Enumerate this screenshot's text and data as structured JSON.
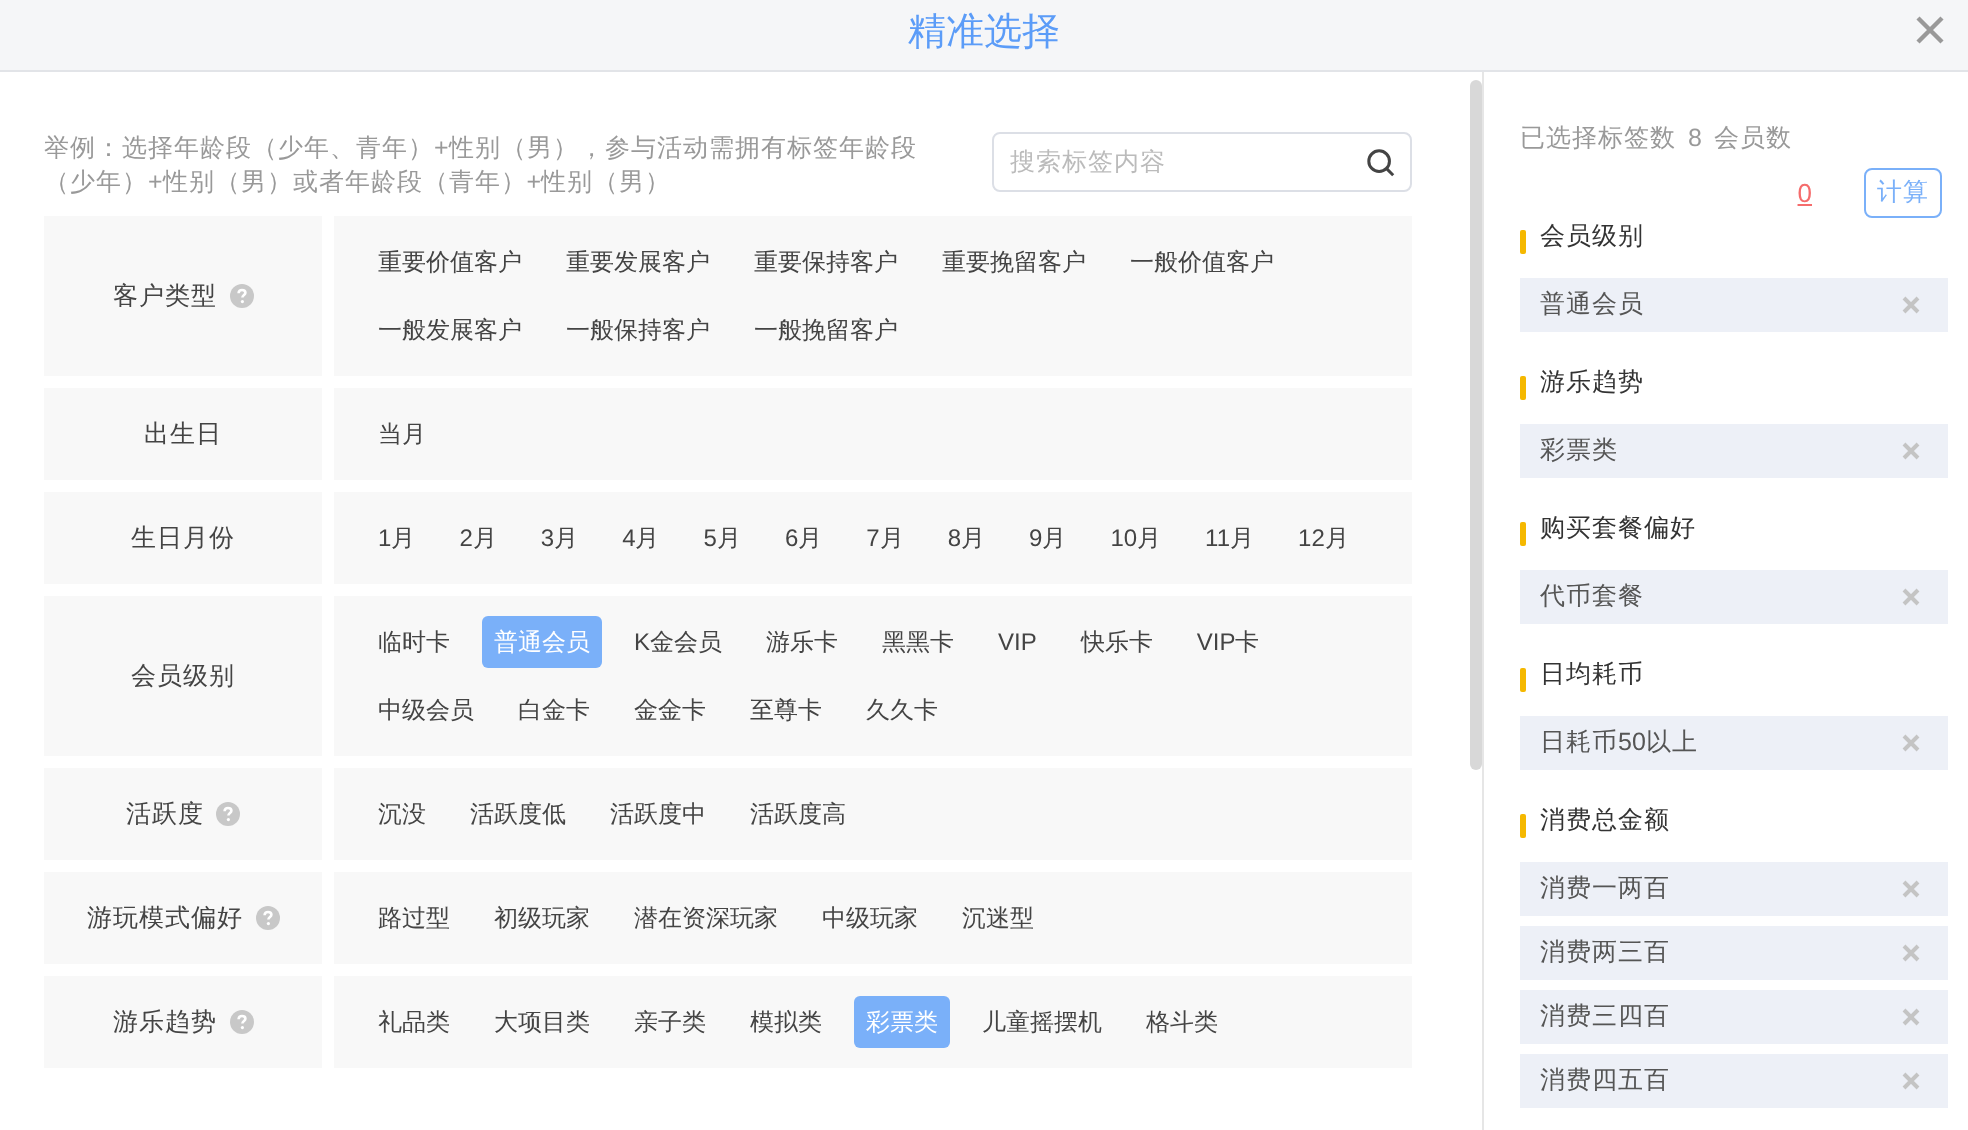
{
  "dialog": {
    "title": "精准选择"
  },
  "hint": "举例：选择年龄段（少年、青年）+性别（男），参与活动需拥有标签年龄段（少年）+性别（男）或者年龄段（青年）+性别（男）",
  "search": {
    "placeholder": "搜索标签内容"
  },
  "categories": [
    {
      "label": "客户类型",
      "help": true,
      "tags": [
        {
          "label": "重要价值客户",
          "selected": false
        },
        {
          "label": "重要发展客户",
          "selected": false
        },
        {
          "label": "重要保持客户",
          "selected": false
        },
        {
          "label": "重要挽留客户",
          "selected": false
        },
        {
          "label": "一般价值客户",
          "selected": false
        },
        {
          "label": "一般发展客户",
          "selected": false
        },
        {
          "label": "一般保持客户",
          "selected": false
        },
        {
          "label": "一般挽留客户",
          "selected": false
        }
      ]
    },
    {
      "label": "出生日",
      "help": false,
      "tags": [
        {
          "label": "当月",
          "selected": false
        }
      ]
    },
    {
      "label": "生日月份",
      "help": false,
      "tags": [
        {
          "label": "1月",
          "selected": false
        },
        {
          "label": "2月",
          "selected": false
        },
        {
          "label": "3月",
          "selected": false
        },
        {
          "label": "4月",
          "selected": false
        },
        {
          "label": "5月",
          "selected": false
        },
        {
          "label": "6月",
          "selected": false
        },
        {
          "label": "7月",
          "selected": false
        },
        {
          "label": "8月",
          "selected": false
        },
        {
          "label": "9月",
          "selected": false
        },
        {
          "label": "10月",
          "selected": false
        },
        {
          "label": "11月",
          "selected": false
        },
        {
          "label": "12月",
          "selected": false
        }
      ]
    },
    {
      "label": "会员级别",
      "help": false,
      "tags": [
        {
          "label": "临时卡",
          "selected": false
        },
        {
          "label": "普通会员",
          "selected": true
        },
        {
          "label": "K金会员",
          "selected": false
        },
        {
          "label": "游乐卡",
          "selected": false
        },
        {
          "label": "黑黑卡",
          "selected": false
        },
        {
          "label": "VIP",
          "selected": false
        },
        {
          "label": "快乐卡",
          "selected": false
        },
        {
          "label": "VIP卡",
          "selected": false
        },
        {
          "label": "中级会员",
          "selected": false
        },
        {
          "label": "白金卡",
          "selected": false
        },
        {
          "label": "金金卡",
          "selected": false
        },
        {
          "label": "至尊卡",
          "selected": false
        },
        {
          "label": "久久卡",
          "selected": false
        }
      ]
    },
    {
      "label": "活跃度",
      "help": true,
      "tags": [
        {
          "label": "沉没",
          "selected": false
        },
        {
          "label": "活跃度低",
          "selected": false
        },
        {
          "label": "活跃度中",
          "selected": false
        },
        {
          "label": "活跃度高",
          "selected": false
        }
      ]
    },
    {
      "label": "游玩模式偏好",
      "help": true,
      "tags": [
        {
          "label": "路过型",
          "selected": false
        },
        {
          "label": "初级玩家",
          "selected": false
        },
        {
          "label": "潜在资深玩家",
          "selected": false
        },
        {
          "label": "中级玩家",
          "selected": false
        },
        {
          "label": "沉迷型",
          "selected": false
        }
      ]
    },
    {
      "label": "游乐趋势",
      "help": true,
      "tags": [
        {
          "label": "礼品类",
          "selected": false
        },
        {
          "label": "大项目类",
          "selected": false
        },
        {
          "label": "亲子类",
          "selected": false
        },
        {
          "label": "模拟类",
          "selected": false
        },
        {
          "label": "彩票类",
          "selected": true
        },
        {
          "label": "儿童摇摆机",
          "selected": false
        },
        {
          "label": "格斗类",
          "selected": false
        }
      ]
    }
  ],
  "summary": {
    "selected_label": "已选择标签数",
    "selected_count": "8",
    "member_label": "会员数",
    "member_count": "0",
    "calc_button": "计算"
  },
  "selected_groups": [
    {
      "title": "会员级别",
      "items": [
        "普通会员"
      ]
    },
    {
      "title": "游乐趋势",
      "items": [
        "彩票类"
      ]
    },
    {
      "title": "购买套餐偏好",
      "items": [
        "代币套餐"
      ]
    },
    {
      "title": "日均耗币",
      "items": [
        "日耗币50以上"
      ]
    },
    {
      "title": "消费总金额",
      "items": [
        "消费一两百",
        "消费两三百",
        "消费三四百",
        "消费四五百"
      ]
    }
  ]
}
